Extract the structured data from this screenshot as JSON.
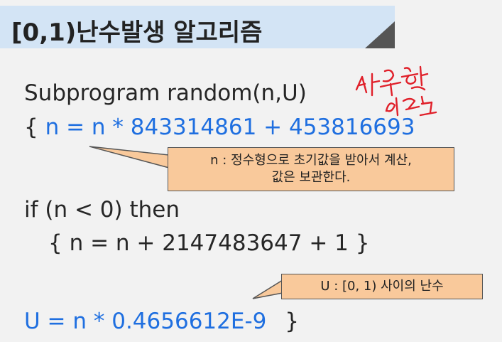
{
  "slide": {
    "title": "[0,1)난수발생 알고리즘",
    "subprogram": "Subprogram random(n,U)",
    "line2_brace": "{",
    "line2_code": "n = n * 843314861 + 453816693",
    "line3": "if (n < 0) then",
    "line4": "{ n = n + 2147483647 + 1 }",
    "line5_code": "U = n * 0.4656612E-9",
    "line5_brace": "}"
  },
  "callouts": {
    "n_line1": "n : 정수형으로 초기값을 받아서 계산,",
    "n_line2": "값은 보관한다.",
    "u": "U :  [0, 1) 사이의 난수"
  },
  "colors": {
    "title_bar": "#d3e4f5",
    "code_blue": "#1f6fe0",
    "callout_fill": "#f9c99b",
    "handwriting": "#e0202a"
  },
  "annotation": {
    "type": "handwritten red ink scribble"
  }
}
